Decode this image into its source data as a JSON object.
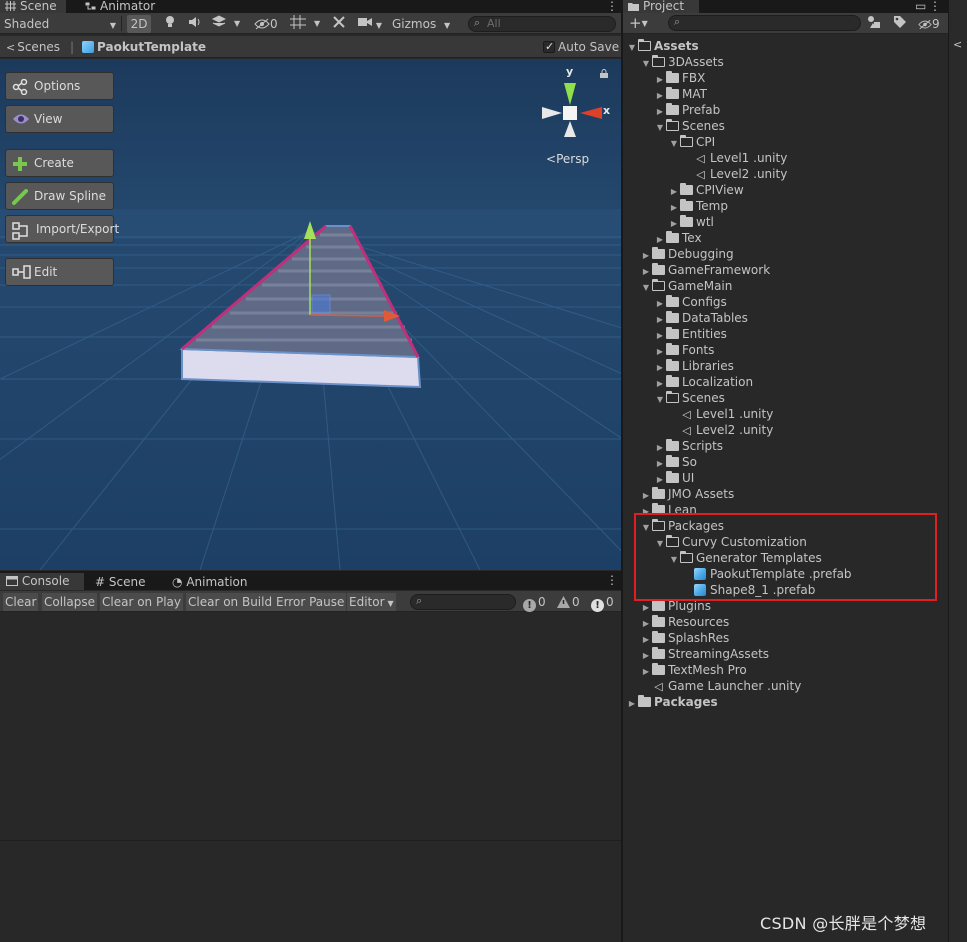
{
  "scene_tabs": {
    "scene": "Scene",
    "animator": "Animator"
  },
  "scene_toolbar": {
    "shading": "Shaded",
    "mode_2d": "2D",
    "hidden_count": "0",
    "gizmos": "Gizmos",
    "search_placeholder": "All"
  },
  "breadcrumb": {
    "scenes": "Scenes",
    "prefab": "PaokutTemplate",
    "auto_save": "Auto Save"
  },
  "viewport": {
    "buttons": {
      "options": "Options",
      "view": "View",
      "create": "Create",
      "draw_spline": "Draw Spline",
      "import_export": "Import/Export",
      "edit": "Edit"
    },
    "gizmo": {
      "y": "y",
      "x": "x",
      "projection": "Persp"
    }
  },
  "console": {
    "tabs": {
      "console": "Console",
      "scene": "Scene",
      "animation": "Animation"
    },
    "toolbar": {
      "clear": "Clear",
      "collapse": "Collapse",
      "clear_on_play": "Clear on Play",
      "clear_on_build": "Clear on Build",
      "error_pause": "Error Pause",
      "editor": "Editor",
      "info_count": "0",
      "warning_count": "0",
      "error_count": "0"
    }
  },
  "project": {
    "tab": "Project",
    "hidden_count": "9",
    "tree": [
      {
        "label": "Assets",
        "depth": 0,
        "kind": "folder-open",
        "arrow": "open",
        "bold": true
      },
      {
        "label": "3DAssets",
        "depth": 1,
        "kind": "folder-open",
        "arrow": "open"
      },
      {
        "label": "FBX",
        "depth": 2,
        "kind": "folder",
        "arrow": "closed"
      },
      {
        "label": "MAT",
        "depth": 2,
        "kind": "folder",
        "arrow": "closed"
      },
      {
        "label": "Prefab",
        "depth": 2,
        "kind": "folder",
        "arrow": "closed"
      },
      {
        "label": "Scenes",
        "depth": 2,
        "kind": "folder-open",
        "arrow": "open"
      },
      {
        "label": "CPI",
        "depth": 3,
        "kind": "folder-open",
        "arrow": "open"
      },
      {
        "label": "Level1 .unity",
        "depth": 4,
        "kind": "unity",
        "arrow": "none"
      },
      {
        "label": "Level2 .unity",
        "depth": 4,
        "kind": "unity",
        "arrow": "none"
      },
      {
        "label": "CPIView",
        "depth": 3,
        "kind": "folder",
        "arrow": "closed"
      },
      {
        "label": "Temp",
        "depth": 3,
        "kind": "folder",
        "arrow": "closed"
      },
      {
        "label": "wtl",
        "depth": 3,
        "kind": "folder",
        "arrow": "closed"
      },
      {
        "label": "Tex",
        "depth": 2,
        "kind": "folder",
        "arrow": "closed"
      },
      {
        "label": "Debugging",
        "depth": 1,
        "kind": "folder",
        "arrow": "closed"
      },
      {
        "label": "GameFramework",
        "depth": 1,
        "kind": "folder",
        "arrow": "closed"
      },
      {
        "label": "GameMain",
        "depth": 1,
        "kind": "folder-open",
        "arrow": "open"
      },
      {
        "label": "Configs",
        "depth": 2,
        "kind": "folder",
        "arrow": "closed"
      },
      {
        "label": "DataTables",
        "depth": 2,
        "kind": "folder",
        "arrow": "closed"
      },
      {
        "label": "Entities",
        "depth": 2,
        "kind": "folder",
        "arrow": "closed"
      },
      {
        "label": "Fonts",
        "depth": 2,
        "kind": "folder",
        "arrow": "closed"
      },
      {
        "label": "Libraries",
        "depth": 2,
        "kind": "folder",
        "arrow": "closed"
      },
      {
        "label": "Localization",
        "depth": 2,
        "kind": "folder",
        "arrow": "closed"
      },
      {
        "label": "Scenes",
        "depth": 2,
        "kind": "folder-open",
        "arrow": "open"
      },
      {
        "label": "Level1 .unity",
        "depth": 3,
        "kind": "unity",
        "arrow": "none"
      },
      {
        "label": "Level2 .unity",
        "depth": 3,
        "kind": "unity",
        "arrow": "none"
      },
      {
        "label": "Scripts",
        "depth": 2,
        "kind": "folder",
        "arrow": "closed"
      },
      {
        "label": "So",
        "depth": 2,
        "kind": "folder",
        "arrow": "closed"
      },
      {
        "label": "UI",
        "depth": 2,
        "kind": "folder",
        "arrow": "closed"
      },
      {
        "label": "JMO Assets",
        "depth": 1,
        "kind": "folder",
        "arrow": "closed"
      },
      {
        "label": "Lean",
        "depth": 1,
        "kind": "folder",
        "arrow": "closed"
      },
      {
        "label": "Packages",
        "depth": 1,
        "kind": "folder-open",
        "arrow": "open"
      },
      {
        "label": "Curvy Customization",
        "depth": 2,
        "kind": "folder-open",
        "arrow": "open"
      },
      {
        "label": "Generator Templates",
        "depth": 3,
        "kind": "folder-open",
        "arrow": "open"
      },
      {
        "label": "PaokutTemplate .prefab",
        "depth": 4,
        "kind": "prefab",
        "arrow": "none"
      },
      {
        "label": "Shape8_1 .prefab",
        "depth": 4,
        "kind": "prefab",
        "arrow": "none"
      },
      {
        "label": "Plugins",
        "depth": 1,
        "kind": "folder",
        "arrow": "closed"
      },
      {
        "label": "Resources",
        "depth": 1,
        "kind": "folder",
        "arrow": "closed"
      },
      {
        "label": "SplashRes",
        "depth": 1,
        "kind": "folder",
        "arrow": "closed"
      },
      {
        "label": "StreamingAssets",
        "depth": 1,
        "kind": "folder",
        "arrow": "closed"
      },
      {
        "label": "TextMesh Pro",
        "depth": 1,
        "kind": "folder",
        "arrow": "closed"
      },
      {
        "label": "Game Launcher .unity",
        "depth": 1,
        "kind": "unity",
        "arrow": "none"
      },
      {
        "label": "Packages",
        "depth": 0,
        "kind": "folder",
        "arrow": "closed",
        "bold": true
      }
    ]
  },
  "colors": {
    "highlight_box": "#e02020",
    "viewport_sky": "#20456b",
    "spline": "#c0307a"
  },
  "watermark": "CSDN @长胖是个梦想"
}
